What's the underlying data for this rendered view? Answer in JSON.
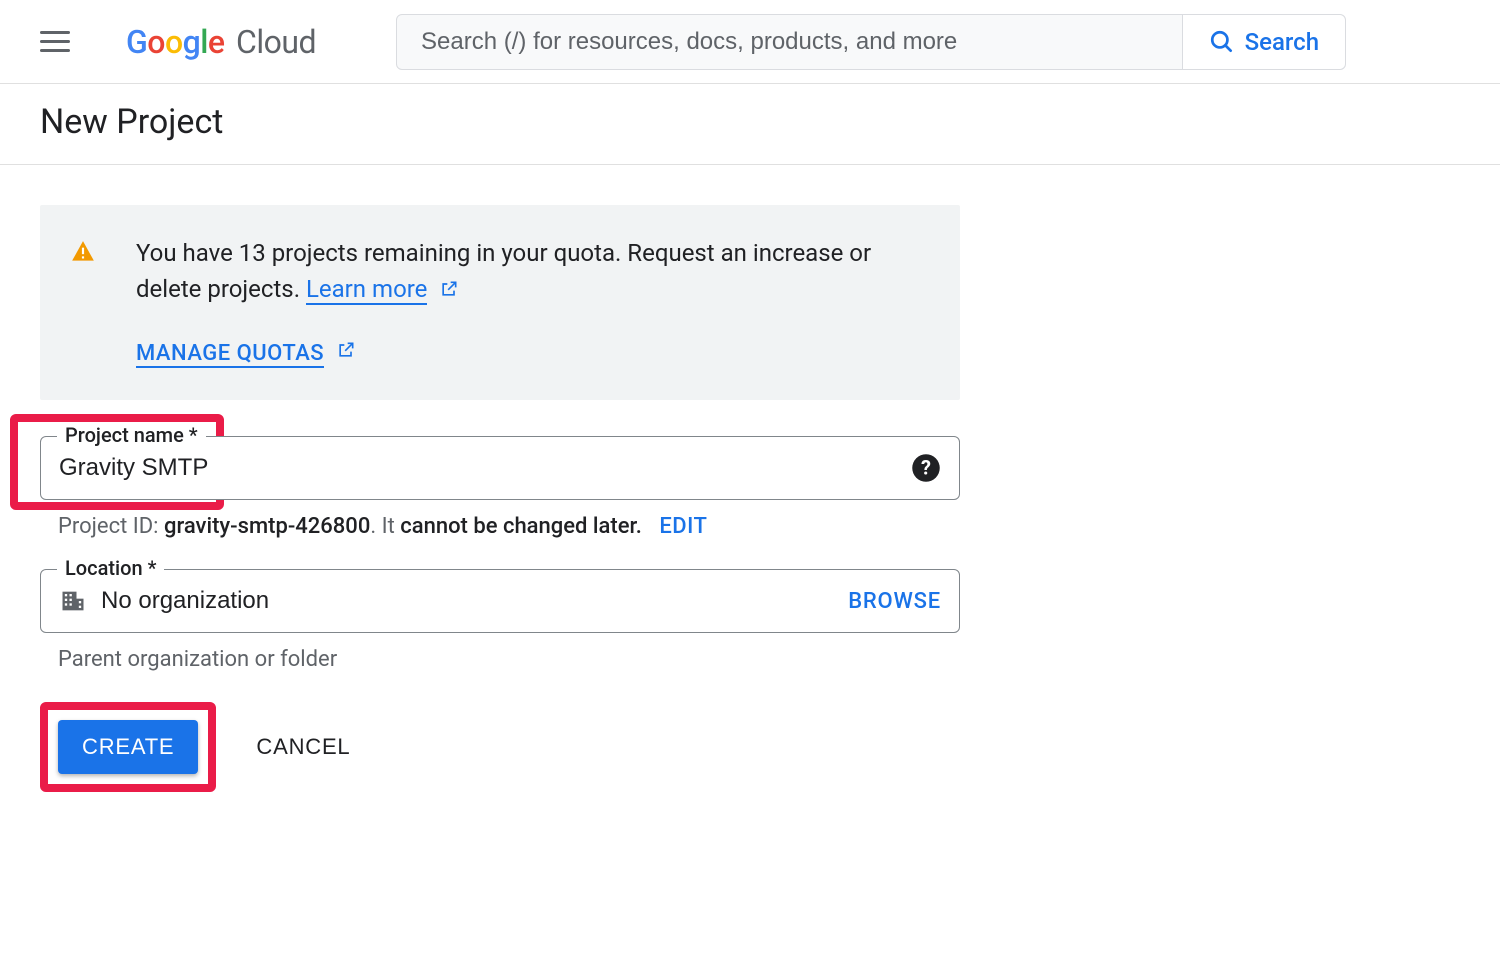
{
  "header": {
    "logo_text": "Google Cloud",
    "search_placeholder": "Search (/) for resources, docs, products, and more",
    "search_button": "Search"
  },
  "page": {
    "title": "New Project"
  },
  "infobox": {
    "quota_text_1": "You have 13 projects remaining in your quota. Request an increase or delete projects. ",
    "learn_more": "Learn more",
    "manage_quotas": "MANAGE QUOTAS"
  },
  "form": {
    "project_name_label": "Project name *",
    "project_name_value": "Gravity SMTP",
    "project_id_prefix": "Project ID: ",
    "project_id_value": "gravity-smtp-426800",
    "project_id_suffix1": ". It ",
    "project_id_suffix2": "cannot be changed later.",
    "edit_label": "EDIT",
    "location_label": "Location *",
    "location_value": "No organization",
    "browse_label": "BROWSE",
    "location_helper": "Parent organization or folder",
    "create_label": "CREATE",
    "cancel_label": "CANCEL"
  }
}
